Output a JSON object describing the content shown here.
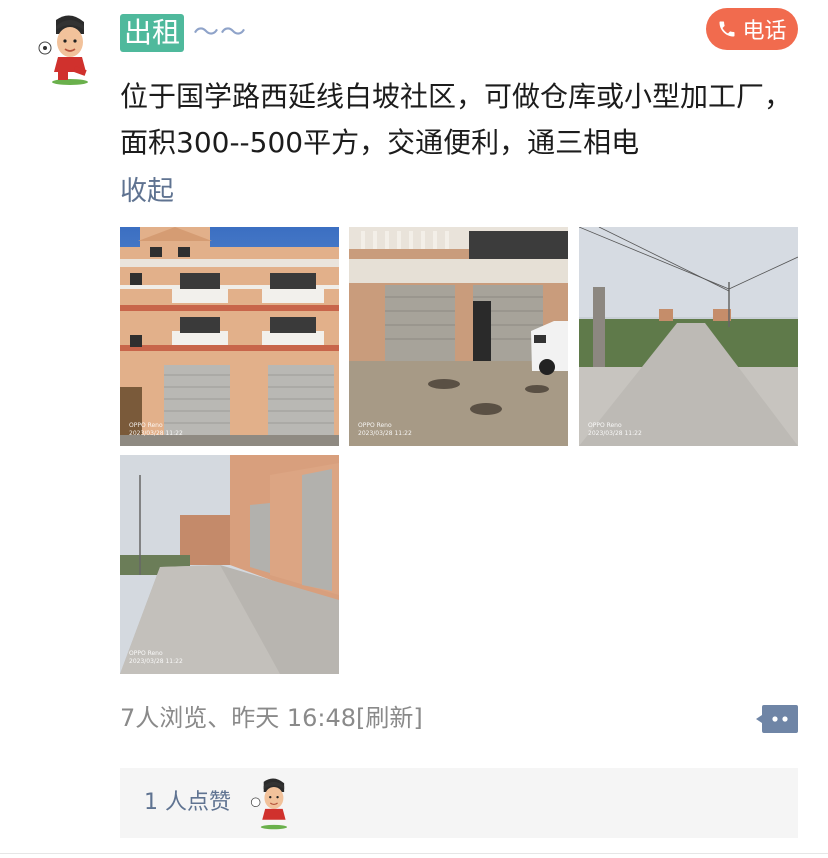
{
  "post": {
    "tag": "出租",
    "tag_suffix": "～～",
    "call_label": "电话",
    "content": "位于国学路西延线白坡社区，可做仓库或小型加工厂，面积300--500平方，交通便利，通三相电",
    "collapse_label": "收起",
    "photo_watermark_brand": "OPPO Reno",
    "photo_watermark_time": "2023/03/28 11:22",
    "meta": "7人浏览、昨天 16:48[刷新]",
    "likes_label": "1 人点赞"
  },
  "colors": {
    "tag_bg": "#4fb99c",
    "call_bg": "#f16b4e",
    "link": "#5f7391",
    "meta": "#8a8a8a"
  },
  "icons": [
    "user-avatar",
    "phone-icon",
    "comment-icon"
  ]
}
